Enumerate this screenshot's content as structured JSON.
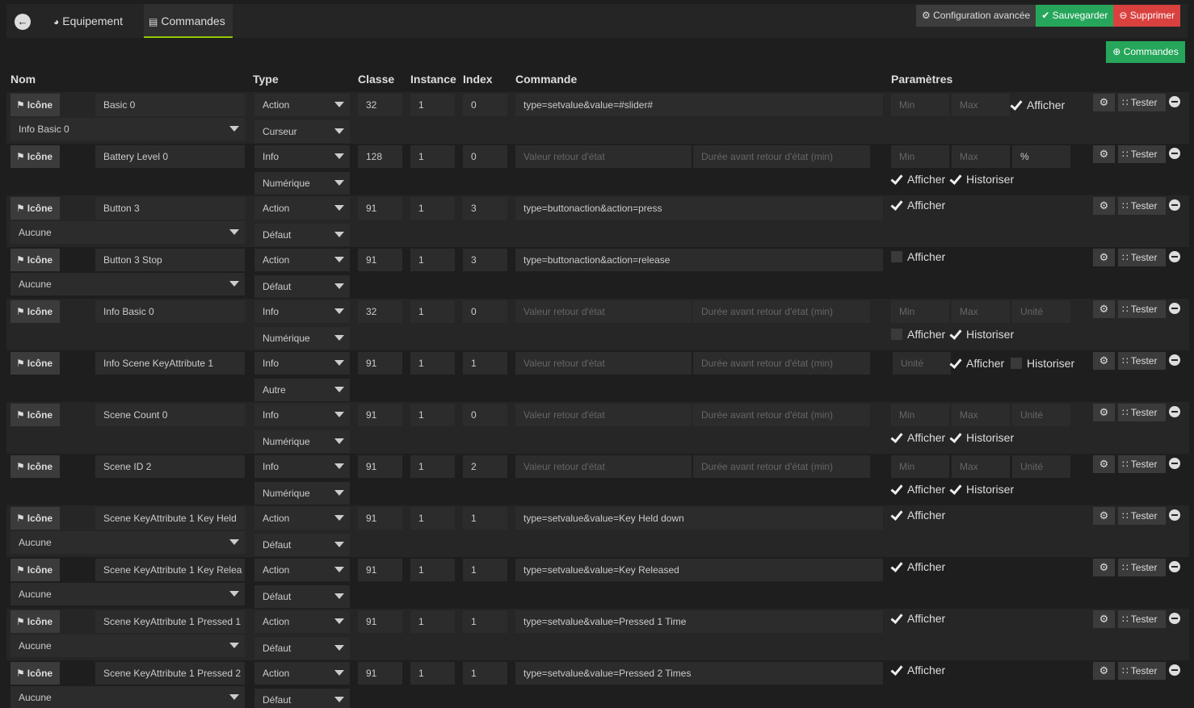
{
  "tabs": {
    "equipement": "Equipement",
    "commandes": "Commandes"
  },
  "actions": {
    "config": "Configuration avancée",
    "save": "Sauvegarder",
    "delete": "Supprimer",
    "add_commands": "Commandes"
  },
  "columns": {
    "nom": "Nom",
    "type": "Type",
    "classe": "Classe",
    "instance": "Instance",
    "index": "Index",
    "commande": "Commande",
    "parametres": "Paramètres"
  },
  "labels": {
    "icone": "Icône",
    "tester": "Tester",
    "afficher": "Afficher",
    "historiser": "Historiser",
    "min": "Min",
    "max": "Max",
    "unite": "Unité",
    "valeur_retour": "Valeur retour d'état",
    "duree_retour": "Durée avant retour d'état (min)"
  },
  "rows": [
    {
      "name": "Basic 0",
      "type": "Action",
      "subtype": "Curseur",
      "classe": "32",
      "instance": "1",
      "index": "0",
      "commande": "type=setvalue&value=#slider#",
      "link": "Info Basic 0",
      "unit": "",
      "afficher": true,
      "historiser": null
    },
    {
      "name": "Battery Level 0",
      "type": "Info",
      "subtype": "Numérique",
      "classe": "128",
      "instance": "1",
      "index": "0",
      "commande": "",
      "link": "",
      "unit": "%",
      "afficher": true,
      "historiser": true
    },
    {
      "name": "Button 3",
      "type": "Action",
      "subtype": "Défaut",
      "classe": "91",
      "instance": "1",
      "index": "3",
      "commande": "type=buttonaction&action=press",
      "link": "Aucune",
      "unit": "",
      "afficher": true,
      "historiser": null
    },
    {
      "name": "Button 3 Stop",
      "type": "Action",
      "subtype": "Défaut",
      "classe": "91",
      "instance": "1",
      "index": "3",
      "commande": "type=buttonaction&action=release",
      "link": "Aucune",
      "unit": "",
      "afficher": false,
      "historiser": null
    },
    {
      "name": "Info Basic 0",
      "type": "Info",
      "subtype": "Numérique",
      "classe": "32",
      "instance": "1",
      "index": "0",
      "commande": "",
      "link": "",
      "unit": "",
      "afficher": false,
      "historiser": true
    },
    {
      "name": "Info Scene KeyAttribute 1",
      "type": "Info",
      "subtype": "Autre",
      "classe": "91",
      "instance": "1",
      "index": "1",
      "commande": "",
      "link": "",
      "unit": "",
      "afficher": true,
      "historiser": false
    },
    {
      "name": "Scene Count 0",
      "type": "Info",
      "subtype": "Numérique",
      "classe": "91",
      "instance": "1",
      "index": "0",
      "commande": "",
      "link": "",
      "unit": "",
      "afficher": true,
      "historiser": true
    },
    {
      "name": "Scene ID 2",
      "type": "Info",
      "subtype": "Numérique",
      "classe": "91",
      "instance": "1",
      "index": "2",
      "commande": "",
      "link": "",
      "unit": "",
      "afficher": true,
      "historiser": true
    },
    {
      "name": "Scene KeyAttribute 1 Key Held",
      "type": "Action",
      "subtype": "Défaut",
      "classe": "91",
      "instance": "1",
      "index": "1",
      "commande": "type=setvalue&value=Key Held down",
      "link": "Aucune",
      "unit": "",
      "afficher": true,
      "historiser": null
    },
    {
      "name": "Scene KeyAttribute 1 Key Relea",
      "type": "Action",
      "subtype": "Défaut",
      "classe": "91",
      "instance": "1",
      "index": "1",
      "commande": "type=setvalue&value=Key Released",
      "link": "Aucune",
      "unit": "",
      "afficher": true,
      "historiser": null
    },
    {
      "name": "Scene KeyAttribute 1 Pressed 1",
      "type": "Action",
      "subtype": "Défaut",
      "classe": "91",
      "instance": "1",
      "index": "1",
      "commande": "type=setvalue&value=Pressed 1 Time",
      "link": "Aucune",
      "unit": "",
      "afficher": true,
      "historiser": null
    },
    {
      "name": "Scene KeyAttribute 1 Pressed 2",
      "type": "Action",
      "subtype": "Défaut",
      "classe": "91",
      "instance": "1",
      "index": "1",
      "commande": "type=setvalue&value=Pressed 2 Times",
      "link": "Aucune",
      "unit": "",
      "afficher": true,
      "historiser": null
    }
  ]
}
